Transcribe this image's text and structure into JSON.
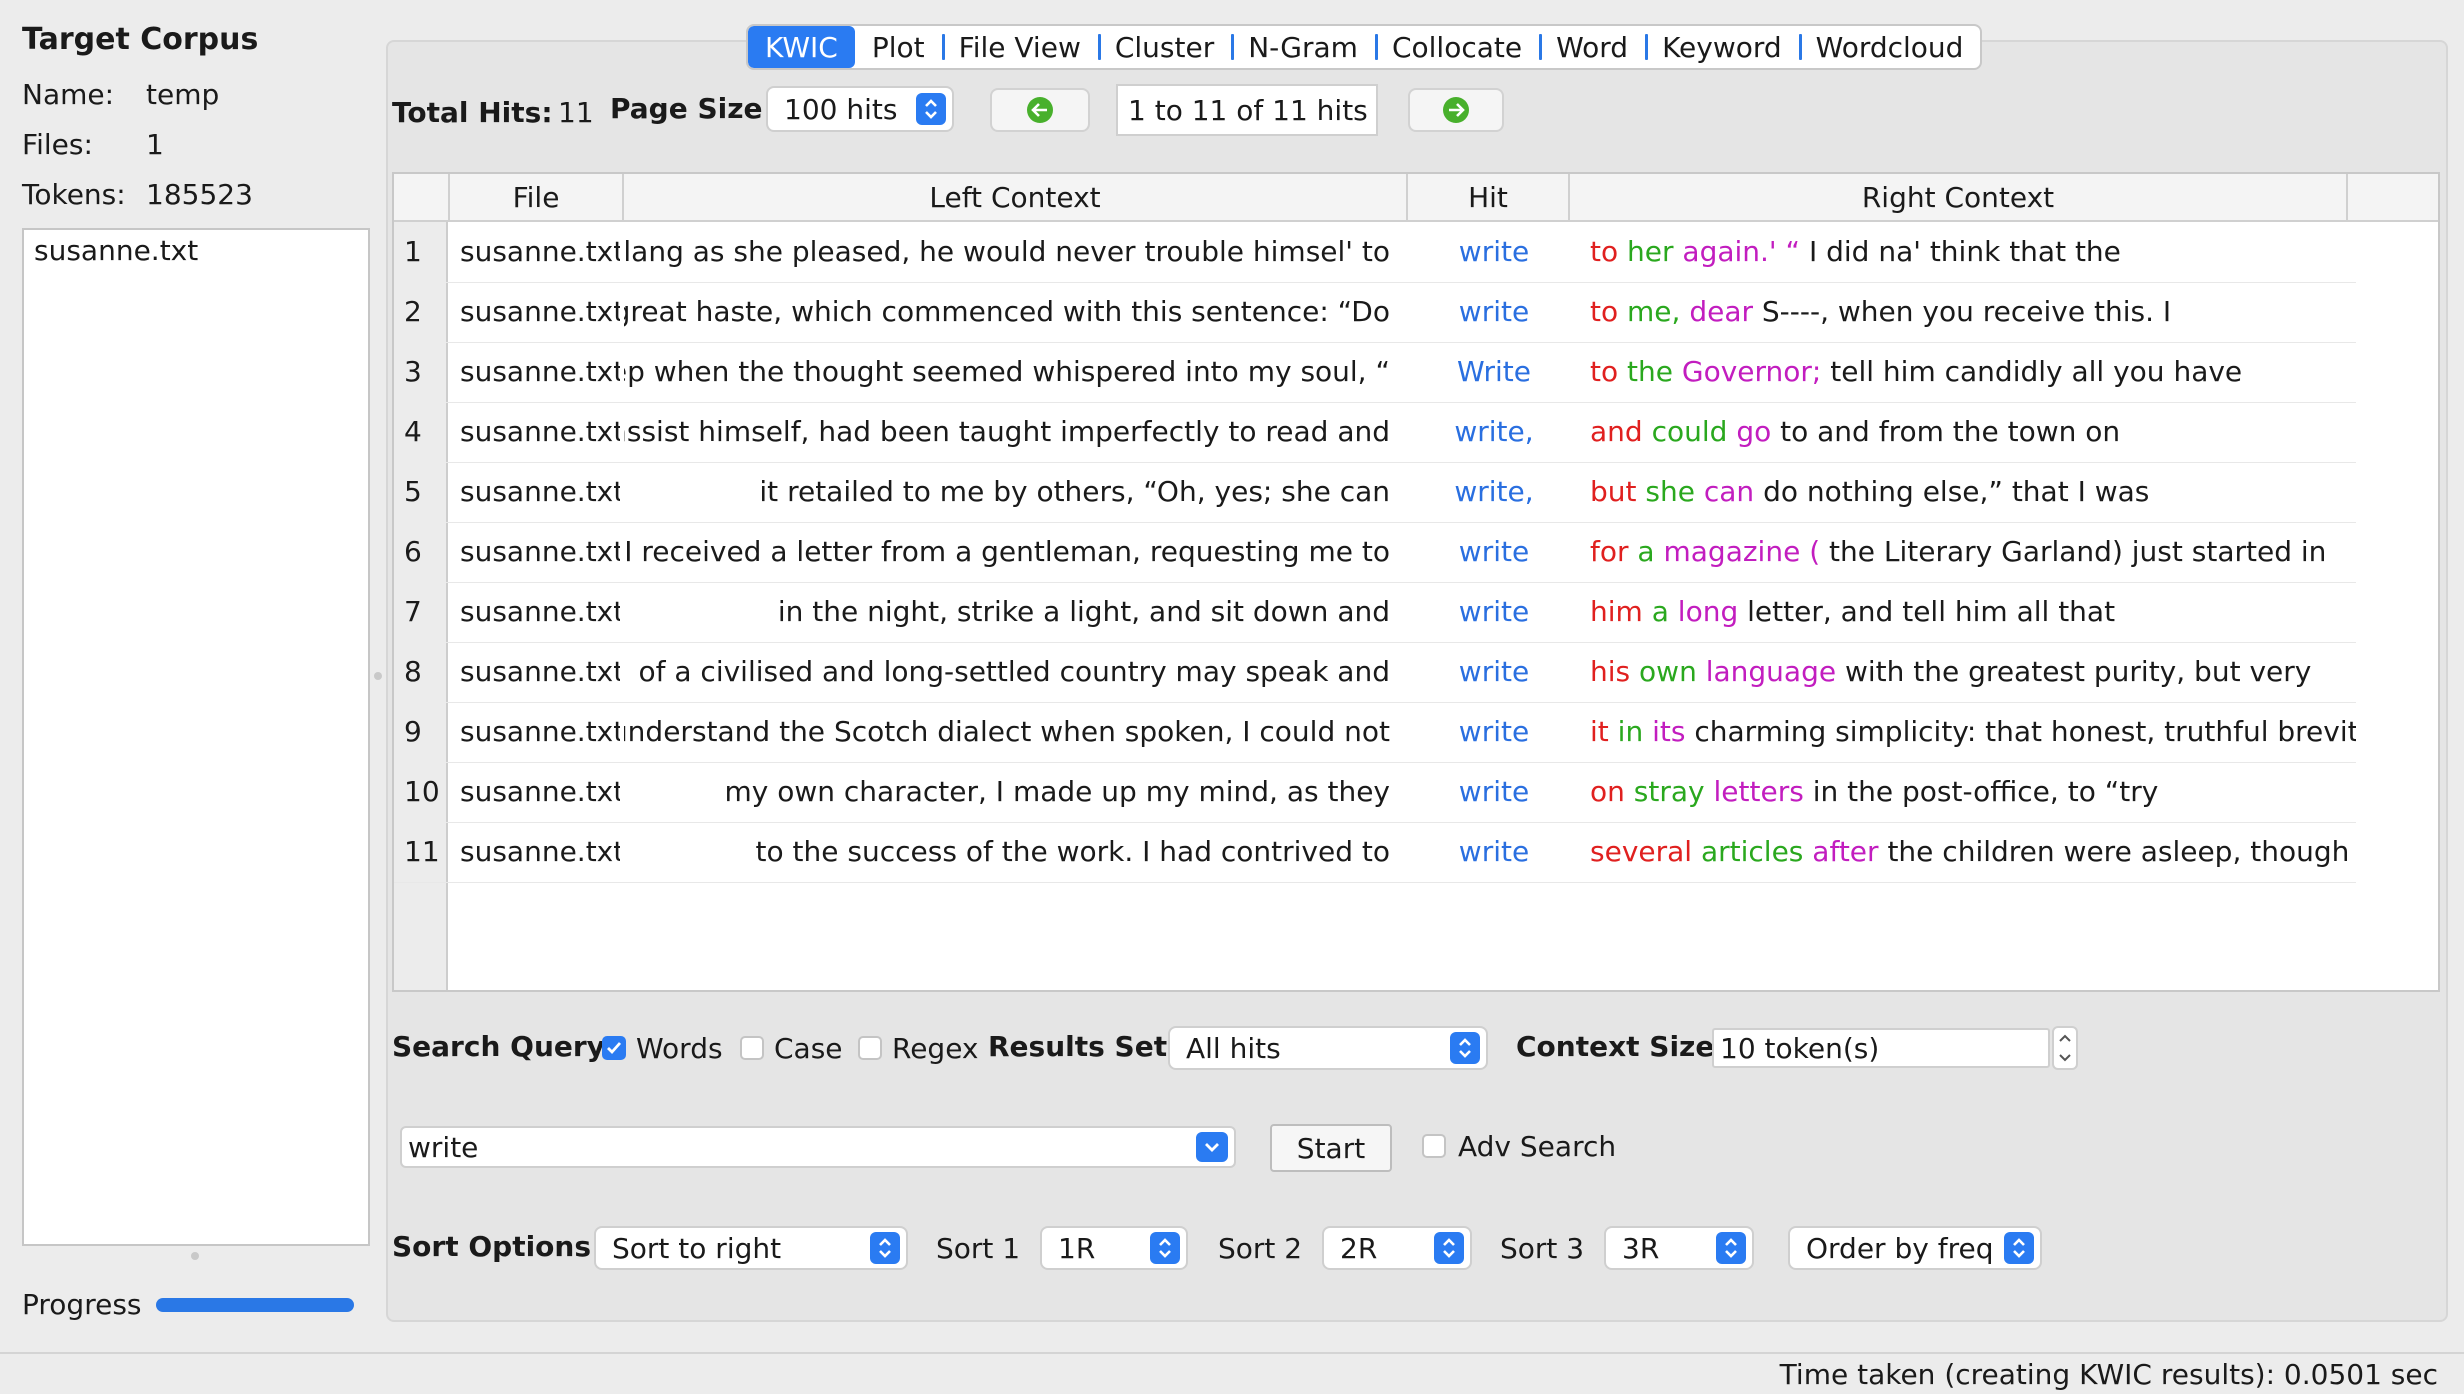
{
  "left_panel": {
    "title": "Target Corpus",
    "name_label": "Name:",
    "name_value": "temp",
    "files_label": "Files:",
    "files_value": "1",
    "tokens_label": "Tokens:",
    "tokens_value": "185523",
    "files": [
      "susanne.txt"
    ],
    "progress_label": "Progress",
    "progress_fraction": 1.0
  },
  "tabs": [
    {
      "label": "KWIC",
      "active": true
    },
    {
      "label": "Plot"
    },
    {
      "label": "File View"
    },
    {
      "label": "Cluster"
    },
    {
      "label": "N-Gram"
    },
    {
      "label": "Collocate"
    },
    {
      "label": "Word"
    },
    {
      "label": "Keyword"
    },
    {
      "label": "Wordcloud"
    }
  ],
  "toolbar": {
    "total_hits_label": "Total Hits:",
    "total_hits_value": "11",
    "page_size_label": "Page Size",
    "page_size_value": "100 hits",
    "page_info": "1 to 11 of 11 hits"
  },
  "table": {
    "headers": {
      "file": "File",
      "left": "Left Context",
      "hit": "Hit",
      "right": "Right Context"
    },
    "rows": [
      {
        "num": "1",
        "file": "susanne.txt",
        "left": "lang as she pleased, he would never trouble himsel' to",
        "hit": "write",
        "r1": "to",
        "r2": "her",
        "r3": "again.' “",
        "rest": "I did na' think that the"
      },
      {
        "num": "2",
        "file": "susanne.txt",
        "left": "in great haste, which commenced with this sentence: “Do",
        "hit": "write",
        "r1": "to",
        "r2": "me,",
        "r3": "dear",
        "rest": "S----, when you receive this. I"
      },
      {
        "num": "3",
        "file": "susanne.txt",
        "left": "sleep when the thought seemed whispered into my soul, “",
        "hit": "Write",
        "r1": "to",
        "r2": "the",
        "r3": "Governor;",
        "rest": "tell him candidly all you have"
      },
      {
        "num": "4",
        "file": "susanne.txt",
        "left": "assist himself, had been taught imperfectly to read and",
        "hit": "write,",
        "r1": "and",
        "r2": "could",
        "r3": "go",
        "rest": "to and from the town on"
      },
      {
        "num": "5",
        "file": "susanne.txt",
        "left": "it retailed to me by others, “Oh, yes; she can",
        "hit": "write,",
        "r1": "but",
        "r2": "she",
        "r3": "can",
        "rest": "do nothing else,” that I was"
      },
      {
        "num": "6",
        "file": "susanne.txt",
        "left": "I received a letter from a gentleman, requesting me to",
        "hit": "write",
        "r1": "for",
        "r2": "a",
        "r3": "magazine (",
        "rest": "the Literary Garland) just started in"
      },
      {
        "num": "7",
        "file": "susanne.txt",
        "left": "in the night, strike a light, and sit down and",
        "hit": "write",
        "r1": "him",
        "r2": "a",
        "r3": "long",
        "rest": "letter, and tell him all that"
      },
      {
        "num": "8",
        "file": "susanne.txt",
        "left": "of a civilised and long-settled country may speak and",
        "hit": "write",
        "r1": "his",
        "r2": "own",
        "r3": "language",
        "rest": "with the greatest purity, but very"
      },
      {
        "num": "9",
        "file": "susanne.txt",
        "left": "understand the Scotch dialect when spoken, I could not",
        "hit": "write",
        "r1": "it",
        "r2": "in",
        "r3": "its",
        "rest": "charming simplicity: that honest, truthful brevity,"
      },
      {
        "num": "10",
        "file": "susanne.txt",
        "left": "my own character, I made up my mind, as they",
        "hit": "write",
        "r1": "on",
        "r2": "stray",
        "r3": "letters",
        "rest": "in the post-office, to “try"
      },
      {
        "num": "11",
        "file": "susanne.txt",
        "left": "to the success of the work. I had contrived to",
        "hit": "write",
        "r1": "several",
        "r2": "articles",
        "r3": "after",
        "rest": "the children were asleep, though the"
      }
    ]
  },
  "search": {
    "query_label": "Search Query",
    "words_label": "Words",
    "words_checked": true,
    "case_label": "Case",
    "case_checked": false,
    "regex_label": "Regex",
    "regex_checked": false,
    "results_set_label": "Results Set",
    "results_set_value": "All hits",
    "context_size_label": "Context Size",
    "context_size_value": "10 token(s)",
    "query_value": "write",
    "start_label": "Start",
    "adv_search_label": "Adv Search",
    "adv_search_checked": false
  },
  "sort": {
    "label": "Sort Options",
    "mode": "Sort to right",
    "sort1_label": "Sort 1",
    "sort1_value": "1R",
    "sort2_label": "Sort 2",
    "sort2_value": "2R",
    "sort3_label": "Sort 3",
    "sort3_value": "3R",
    "order_value": "Order by freq"
  },
  "status": {
    "text": "Time taken (creating KWIC results):  0.0501 sec"
  },
  "colors": {
    "accent": "#2a7bf2",
    "hit": "#2a6fe0",
    "sort1": "#e0201f",
    "sort2": "#2aa81e",
    "sort3": "#c21dbf",
    "nav_arrow": "#48b02c"
  }
}
